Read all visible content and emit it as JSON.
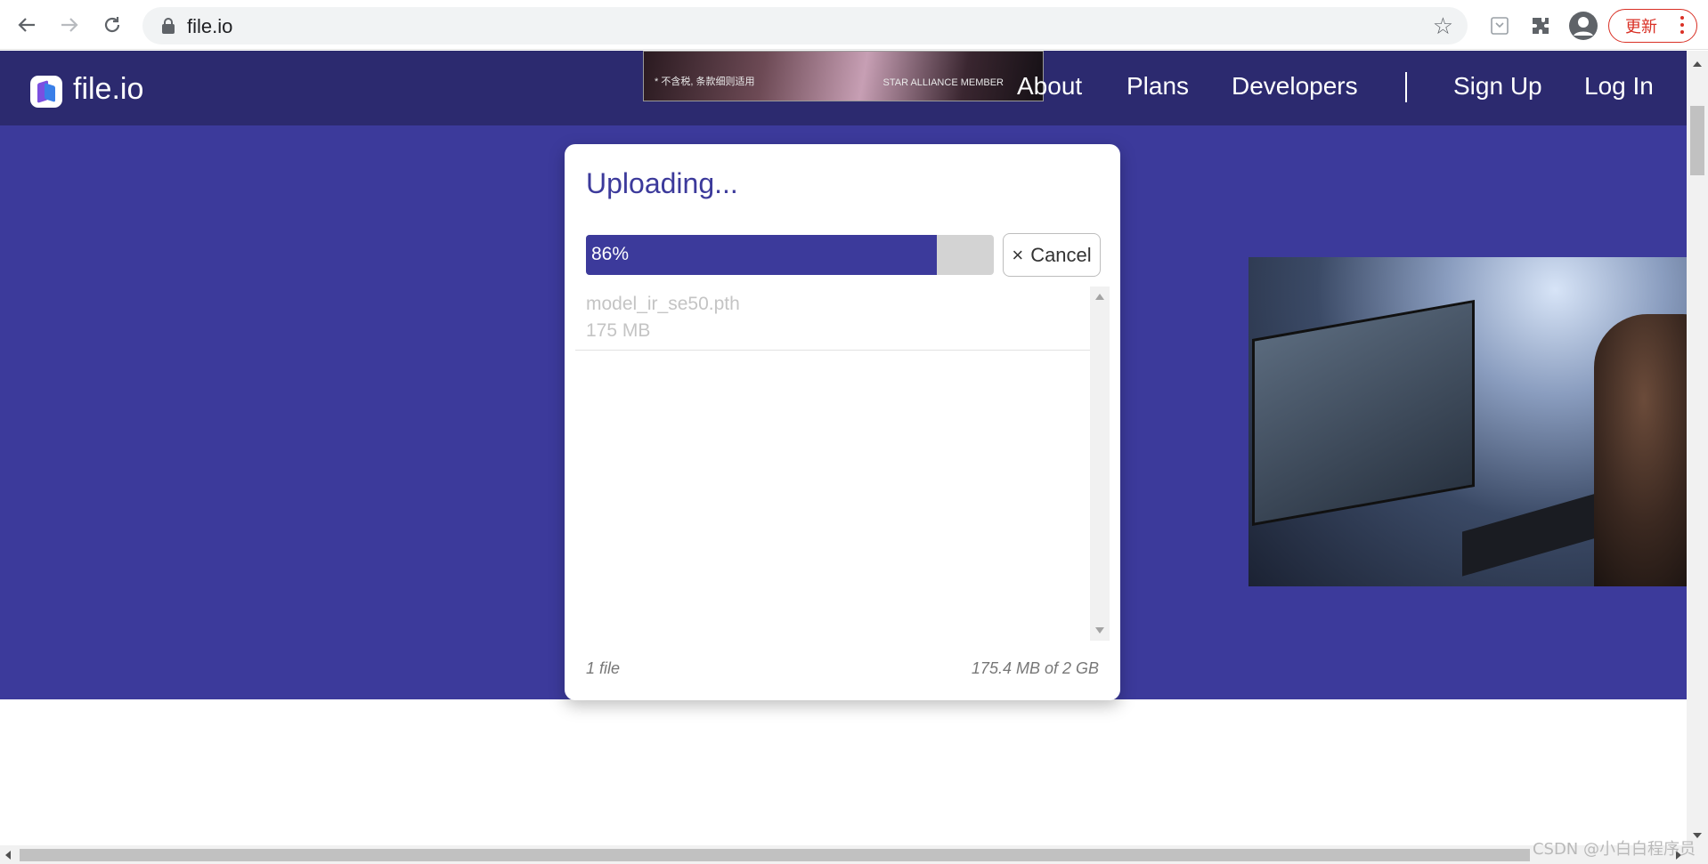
{
  "browser": {
    "url": "file.io",
    "update_label": "更新"
  },
  "site": {
    "logo_text": "file.io",
    "ad_banner": {
      "left_text": "* 不含税, 条款细则适用",
      "right_text": "STAR ALLIANCE MEMBER"
    },
    "nav": {
      "about": "About",
      "plans": "Plans",
      "developers": "Developers",
      "signup": "Sign Up",
      "login": "Log In"
    }
  },
  "upload": {
    "title": "Uploading...",
    "progress_percent": 86,
    "progress_label": "86%",
    "cancel_icon": "×",
    "cancel_label": "Cancel",
    "files": [
      {
        "name": "model_ir_se50.pth",
        "size": "175 MB"
      }
    ],
    "file_count": "1 file",
    "usage": "175.4 MB of 2 GB"
  },
  "watermark": "CSDN @小白白程序员",
  "colors": {
    "header_bg": "#2c2a6f",
    "hero_bg": "#3c3a9b",
    "accent": "#3c3a9b",
    "update_red": "#d93025"
  }
}
